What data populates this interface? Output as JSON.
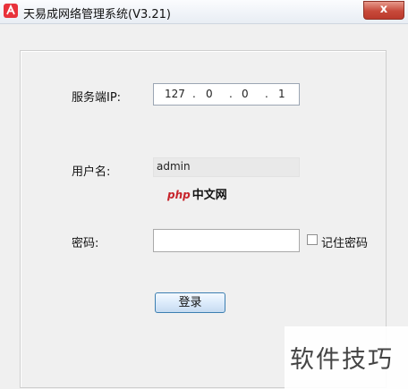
{
  "window": {
    "title": "天易成网络管理系统(V3.21)",
    "close_label": "x"
  },
  "form": {
    "server_ip_label": "服务端IP:",
    "server_ip_segments": [
      "127",
      "0",
      "0",
      "1"
    ],
    "ip_dot": ".",
    "username_label": "用户名:",
    "username_value": "admin",
    "password_label": "密码:",
    "password_value": "",
    "remember_label": "记住密码",
    "remember_checked": false,
    "login_label": "登录"
  },
  "overlay": {
    "logo_php": "php",
    "logo_cn": "中文网",
    "watermark": "软件技巧"
  },
  "colors": {
    "close_button": "#c7493a",
    "login_border": "#3c7fb1",
    "app_icon": "#e8323b"
  },
  "icons": {
    "app": "app-logo-icon",
    "close": "close-icon"
  }
}
